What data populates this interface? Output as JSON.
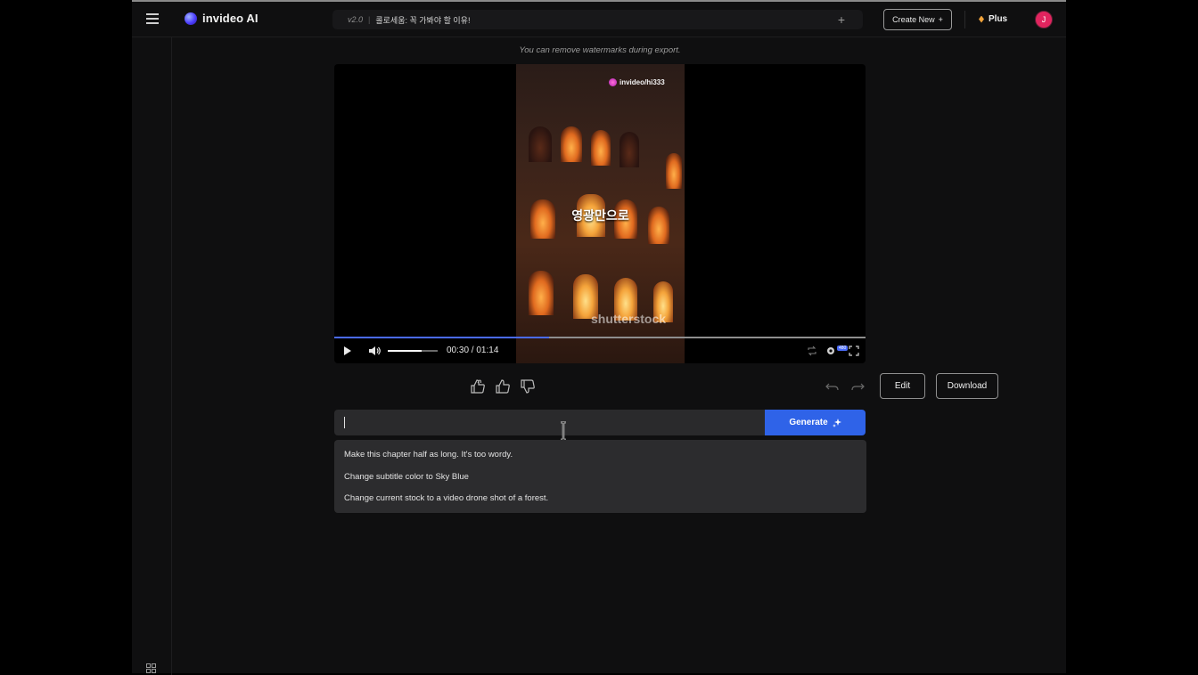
{
  "app": {
    "name": "invideo AI",
    "version": "v2.0",
    "project_title": "콜로세움: 꼭 가봐야 할 이유!",
    "create_new_label": "Create New",
    "plan_label": "Plus",
    "avatar_initial": "J"
  },
  "notice": "You can remove watermarks during export.",
  "video": {
    "channel_handle": "invideo/hi333",
    "subtitle": "영광만으로",
    "watermark": "shutterstock",
    "current_time": "00:30",
    "duration": "01:14",
    "time_display": "00:30 / 01:14",
    "progress_fraction": 0.405,
    "volume_fraction": 0.68,
    "quality_badge": "480"
  },
  "actions": {
    "edit_label": "Edit",
    "download_label": "Download"
  },
  "prompt": {
    "value": "",
    "placeholder": "",
    "generate_label": "Generate"
  },
  "suggestions": [
    "Make this chapter half as long. It's too wordy.",
    "Change subtitle color to Sky Blue",
    "Change current stock to a video drone shot of a forest."
  ],
  "colors": {
    "accent": "#2f63e8",
    "progress": "#4a6bf7",
    "avatar": "#e0245e",
    "plan_diamond": "#f2a33a"
  }
}
